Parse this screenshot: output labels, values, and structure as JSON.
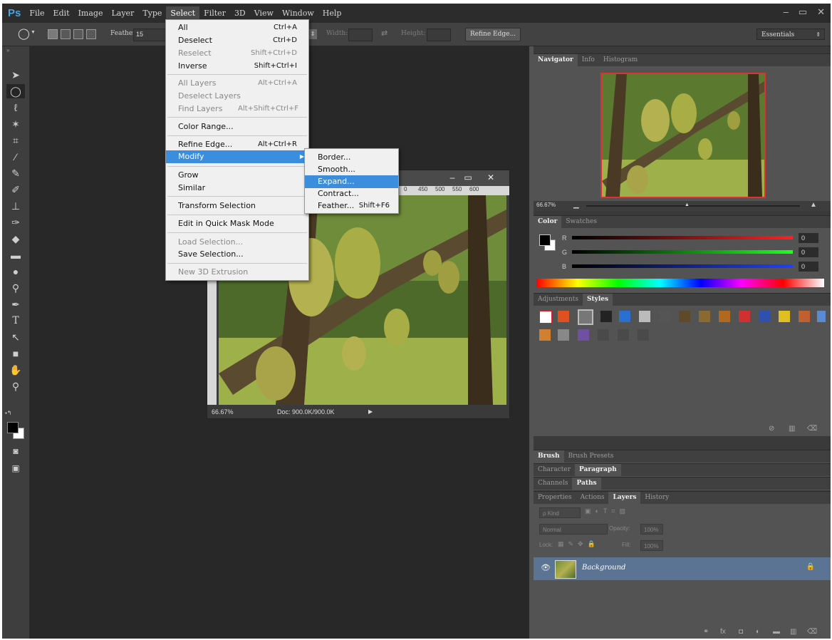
{
  "app": {
    "logo": "Ps"
  },
  "menubar": {
    "items": [
      "File",
      "Edit",
      "Image",
      "Layer",
      "Type",
      "Select",
      "Filter",
      "3D",
      "View",
      "Window",
      "Help"
    ],
    "active": "Select"
  },
  "window_controls": {
    "minimize": "–",
    "restore": "▭",
    "close": "✕"
  },
  "options": {
    "feather_label": "Feather:",
    "feather_value": "15",
    "width_label": "Width:",
    "height_label": "Height:",
    "refine_edge": "Refine Edge...",
    "workspace": "Essentials"
  },
  "select_menu": {
    "items": [
      {
        "label": "All",
        "shortcut": "Ctrl+A",
        "disabled": false
      },
      {
        "label": "Deselect",
        "shortcut": "Ctrl+D",
        "disabled": false
      },
      {
        "label": "Reselect",
        "shortcut": "Shift+Ctrl+D",
        "disabled": true
      },
      {
        "label": "Inverse",
        "shortcut": "Shift+Ctrl+I",
        "disabled": false
      },
      {
        "label": "All Layers",
        "shortcut": "Alt+Ctrl+A",
        "disabled": true
      },
      {
        "label": "Deselect Layers",
        "shortcut": "",
        "disabled": true
      },
      {
        "label": "Find Layers",
        "shortcut": "Alt+Shift+Ctrl+F",
        "disabled": true
      },
      {
        "label": "Color Range...",
        "shortcut": "",
        "disabled": false
      },
      {
        "label": "Refine Edge...",
        "shortcut": "Alt+Ctrl+R",
        "disabled": false
      },
      {
        "label": "Modify",
        "shortcut": "",
        "disabled": false
      },
      {
        "label": "Grow",
        "shortcut": "",
        "disabled": false
      },
      {
        "label": "Similar",
        "shortcut": "",
        "disabled": false
      },
      {
        "label": "Transform Selection",
        "shortcut": "",
        "disabled": false
      },
      {
        "label": "Edit in Quick Mask Mode",
        "shortcut": "",
        "disabled": false
      },
      {
        "label": "Load Selection...",
        "shortcut": "",
        "disabled": true
      },
      {
        "label": "Save Selection...",
        "shortcut": "",
        "disabled": false
      },
      {
        "label": "New 3D Extrusion",
        "shortcut": "",
        "disabled": true
      }
    ],
    "submenu_arrow": "▶"
  },
  "modify_submenu": {
    "items": [
      {
        "label": "Border...",
        "shortcut": ""
      },
      {
        "label": "Smooth...",
        "shortcut": ""
      },
      {
        "label": "Expand...",
        "shortcut": ""
      },
      {
        "label": "Contract...",
        "shortcut": ""
      },
      {
        "label": "Feather...",
        "shortcut": "Shift+F6"
      }
    ],
    "highlighted": "Expand..."
  },
  "document": {
    "ruler_top": [
      "0",
      "450",
      "500",
      "550",
      "600"
    ],
    "zoom": "66.67%",
    "doc_info": "Doc: 900.0K/900.0K"
  },
  "navigator": {
    "tabs": [
      "Navigator",
      "Info",
      "Histogram"
    ],
    "active": "Navigator",
    "zoom": "66.67%"
  },
  "color_panel": {
    "tabs": [
      "Color",
      "Swatches"
    ],
    "active": "Color",
    "channels": [
      {
        "label": "R",
        "value": "0"
      },
      {
        "label": "G",
        "value": "0"
      },
      {
        "label": "B",
        "value": "0"
      }
    ]
  },
  "styles_panel": {
    "tabs": [
      "Adjustments",
      "Styles"
    ],
    "active": "Styles"
  },
  "collapsed_panels": [
    {
      "tabs": [
        "Brush",
        "Brush Presets"
      ],
      "active": "Brush"
    },
    {
      "tabs": [
        "Character",
        "Paragraph"
      ],
      "active": "Paragraph"
    },
    {
      "tabs": [
        "Channels",
        "Paths"
      ],
      "active": "Paths"
    }
  ],
  "layers_panel": {
    "tabs": [
      "Properties",
      "Actions",
      "Layers",
      "History"
    ],
    "active": "Layers",
    "kind_filter": "ρ Kind",
    "blend_mode": "Normal",
    "opacity_label": "Opacity:",
    "opacity_value": "100%",
    "lock_label": "Lock:",
    "fill_label": "Fill:",
    "fill_value": "100%",
    "layers": [
      {
        "name": "Background",
        "locked": true
      }
    ]
  },
  "colors": {
    "menu_highlight": "#3b8ddd",
    "layer_selected": "#5b7494",
    "nav_frame": "#e03030"
  }
}
